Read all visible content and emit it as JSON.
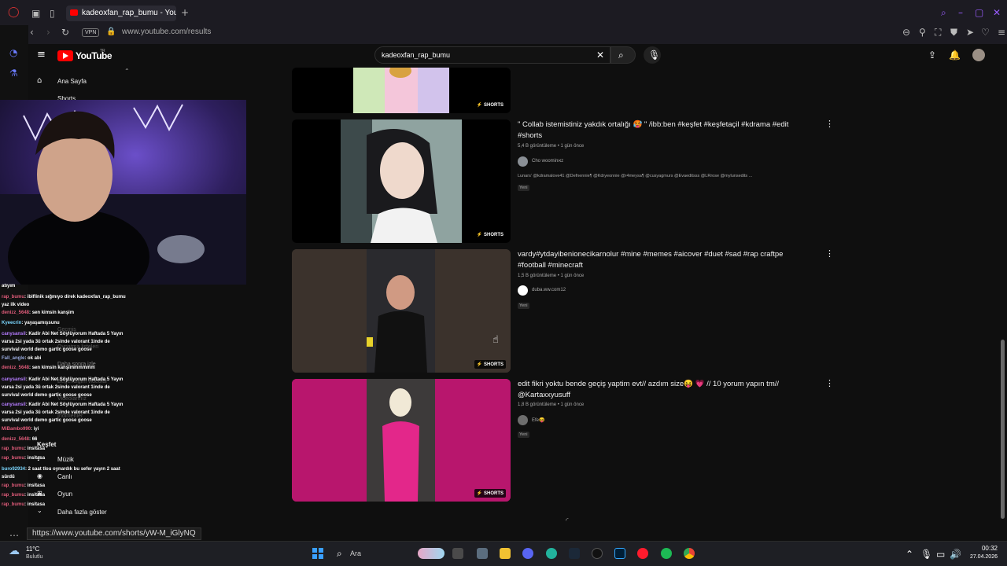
{
  "browser": {
    "tab_title": "kadeoxfan_rap_bumu - YouTube",
    "vpn_label": "VPN",
    "url": "www.youtube.com/results"
  },
  "youtube": {
    "logo_text": "YouTube",
    "logo_sup": "TR",
    "search_value": "kadeoxfan_rap_bumu",
    "nav": [
      {
        "label": "Ana Sayfa",
        "icon": "home-icon"
      },
      {
        "label": "Shorts",
        "icon": "shorts-icon"
      }
    ],
    "nav_faded": [
      {
        "label": "Geçmiş"
      },
      {
        "label": "Oynatma listeleri"
      },
      {
        "label": "Daha sonra izle"
      },
      {
        "label": "Beğendiğim videolar"
      },
      {
        "label": "Videolarınız"
      },
      {
        "label": "İndirilenler"
      }
    ],
    "nav_explore_title": "Keşfet",
    "nav_explore": [
      {
        "label": "Müzik",
        "icon": "music-icon"
      },
      {
        "label": "Canlı",
        "icon": "live-icon"
      },
      {
        "label": "Oyun",
        "icon": "game-icon"
      },
      {
        "label": "Daha fazla göster",
        "icon": "chevron-down-icon"
      }
    ],
    "results": [
      {
        "badge": "SHORTS",
        "title": "",
        "views": "",
        "channel": "",
        "description": "",
        "tag": ""
      },
      {
        "badge": "SHORTS",
        "title": "\" Collab istemistiniz yakdık ortalığı 🥵 \" /ibb:ben #keşfet #keşfetaçil #kdrama #edit #shorts",
        "views": "5,4 B görüntüleme • 1 gün önce",
        "channel": "Cho woominאz",
        "description": "Lunars’ @kdramalove41 @Defnennie¶ @Kdryeonnie @r4meysa¶ @cusyagmurs @Evaeditsss @LRrose @mylunsedits ...",
        "tag": "Yeni"
      },
      {
        "badge": "SHORTS",
        "title": "vardy#ytdayibenionecikarnolur #mine #memes #aicover #duet #sad #rap craftpe #football #minecraft",
        "views": "1,5 B görüntüleme • 1 gün önce",
        "channel": "duba.ww.com12",
        "description": "",
        "tag": "Yeni"
      },
      {
        "badge": "SHORTS",
        "title": "edit fikri yoktu bende geçiş yaptim evt// azdım size😝 💗 // 10 yorum yapın tm// @Kartaxxyusuff",
        "views": "1,8 B görüntüleme • 1 gün önce",
        "channel": "Efe😝",
        "description": "",
        "tag": "Yeni"
      }
    ]
  },
  "chat": [
    {
      "user": "",
      "text": "atıyım"
    },
    {
      "user": "rap_bumu",
      "text": ": ibiflinik sığmıyo direk kadeoxfan_rap_bumu yaz ilk video"
    },
    {
      "user": "denizz_5648",
      "text": ": sen kimsin kanşim"
    },
    {
      "user": "Kyeecrin",
      "text": ": yayaşamışsunu"
    },
    {
      "user": "canysansil",
      "text": ": Kadir Abi Net Söylüyorum Haftada 5 Yayın varsa 2si yada 3ü ortak 2sinde valorant 1inde de survival world demo gartic goose goose"
    },
    {
      "user": "Fall_angle",
      "text": ": ok abi"
    },
    {
      "user": "denizz_5648",
      "text": ": sen kimsin kanşimmmmmm"
    },
    {
      "user": "canysansil",
      "text": ": Kadir Abi Net Söylüyorum Haftada 5 Yayın varsa 2si yada 3ü ortak 2sinde valorant 1inde de survival world demo gartic goose goose"
    },
    {
      "user": "canysansil",
      "text": ": Kadir Abi Net Söylüyorum Haftada 5 Yayın varsa 2si yada 3ü ortak 2sinde valorant 1inde de survival world demo gartic goose goose"
    },
    {
      "user": "MiBambo990",
      "text": ": iyi"
    },
    {
      "user": "denizz_5648",
      "text": ": 66"
    },
    {
      "user": "rap_bumu",
      "text": ": insitasa"
    },
    {
      "user": "rap_bumu",
      "text": ": insitasa"
    },
    {
      "user": "buro92934",
      "text": ": 2 saat tlou oynardık bu sefer yayın 2 saat sürdü"
    },
    {
      "user": "rap_bumu",
      "text": ": insitasa"
    },
    {
      "user": "rap_bumu",
      "text": ": insitasa"
    },
    {
      "user": "rap_bumu",
      "text": ": insitasa"
    }
  ],
  "status_url": "https://www.youtube.com/shorts/yW-M_iGlyNQ",
  "taskbar": {
    "weather_temp": "11°C",
    "weather_desc": "Bulutlu",
    "search_label": "Ara",
    "time": "00:32",
    "date": "27.04.2026"
  }
}
